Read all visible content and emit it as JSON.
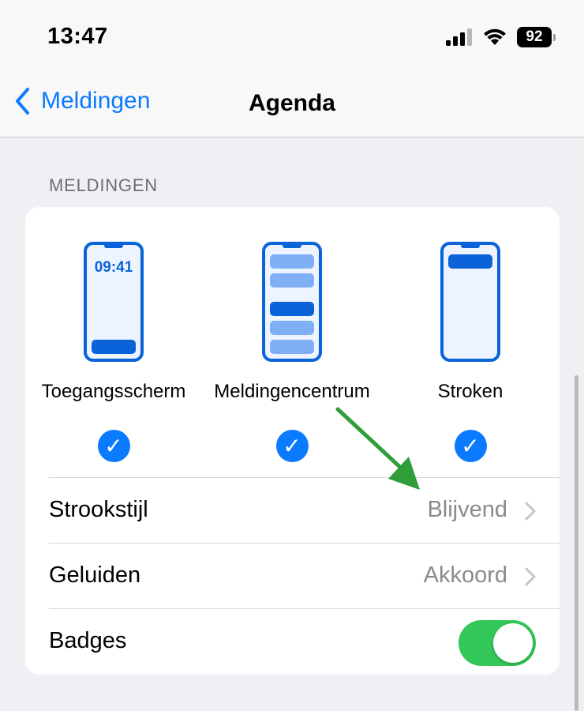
{
  "status_bar": {
    "time": "13:47",
    "battery": "92",
    "icons": [
      "cellular-signal-icon",
      "wifi-icon",
      "battery-icon"
    ]
  },
  "nav": {
    "back_label": "Meldingen",
    "title": "Agenda"
  },
  "section": {
    "header": "MELDINGEN"
  },
  "alert_styles": [
    {
      "label": "Toegangsscherm",
      "preview_time": "09:41",
      "checked": true
    },
    {
      "label": "Meldingencentrum",
      "checked": true
    },
    {
      "label": "Stroken",
      "checked": true
    }
  ],
  "rows": {
    "banner_style": {
      "label": "Strookstijl",
      "value": "Blijvend"
    },
    "sounds": {
      "label": "Geluiden",
      "value": "Akkoord"
    },
    "badges": {
      "label": "Badges",
      "on": true
    }
  },
  "colors": {
    "accent": "#0a7aff",
    "toggle_on": "#34c759",
    "annotation_arrow": "#2f9e3a"
  }
}
